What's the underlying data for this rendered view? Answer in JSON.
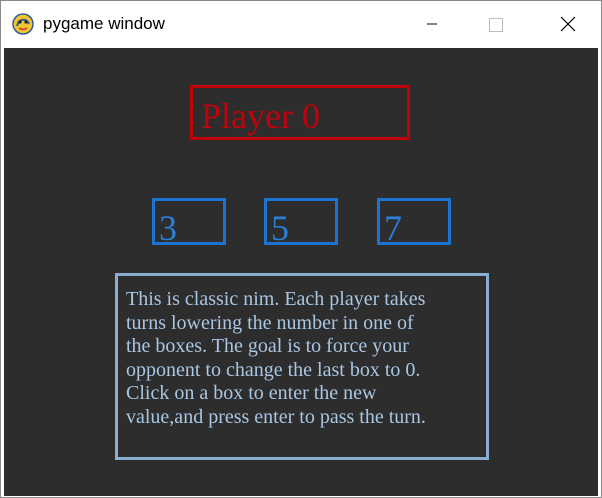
{
  "window": {
    "title": "pygame window"
  },
  "icons": {
    "app": "pygame-snake-icon",
    "minimize": "minimize-icon",
    "maximize": "maximize-icon",
    "close": "close-icon"
  },
  "game": {
    "player_label": "Player 0",
    "heaps": [
      "3",
      "5",
      "7"
    ],
    "instructions": [
      "This is classic nim. Each player takes",
      "turns lowering the number in one of",
      "the boxes. The goal is to force your",
      "opponent to change the last box to 0.",
      "Click on a box to enter the new",
      "value,and press enter to pass the turn."
    ]
  },
  "colors": {
    "background": "#2d2d2d",
    "player_box": "#c0020a",
    "heap_box": "#1d74d0",
    "instructions_border": "#8aaed0",
    "instructions_text": "#a9c6e3"
  }
}
